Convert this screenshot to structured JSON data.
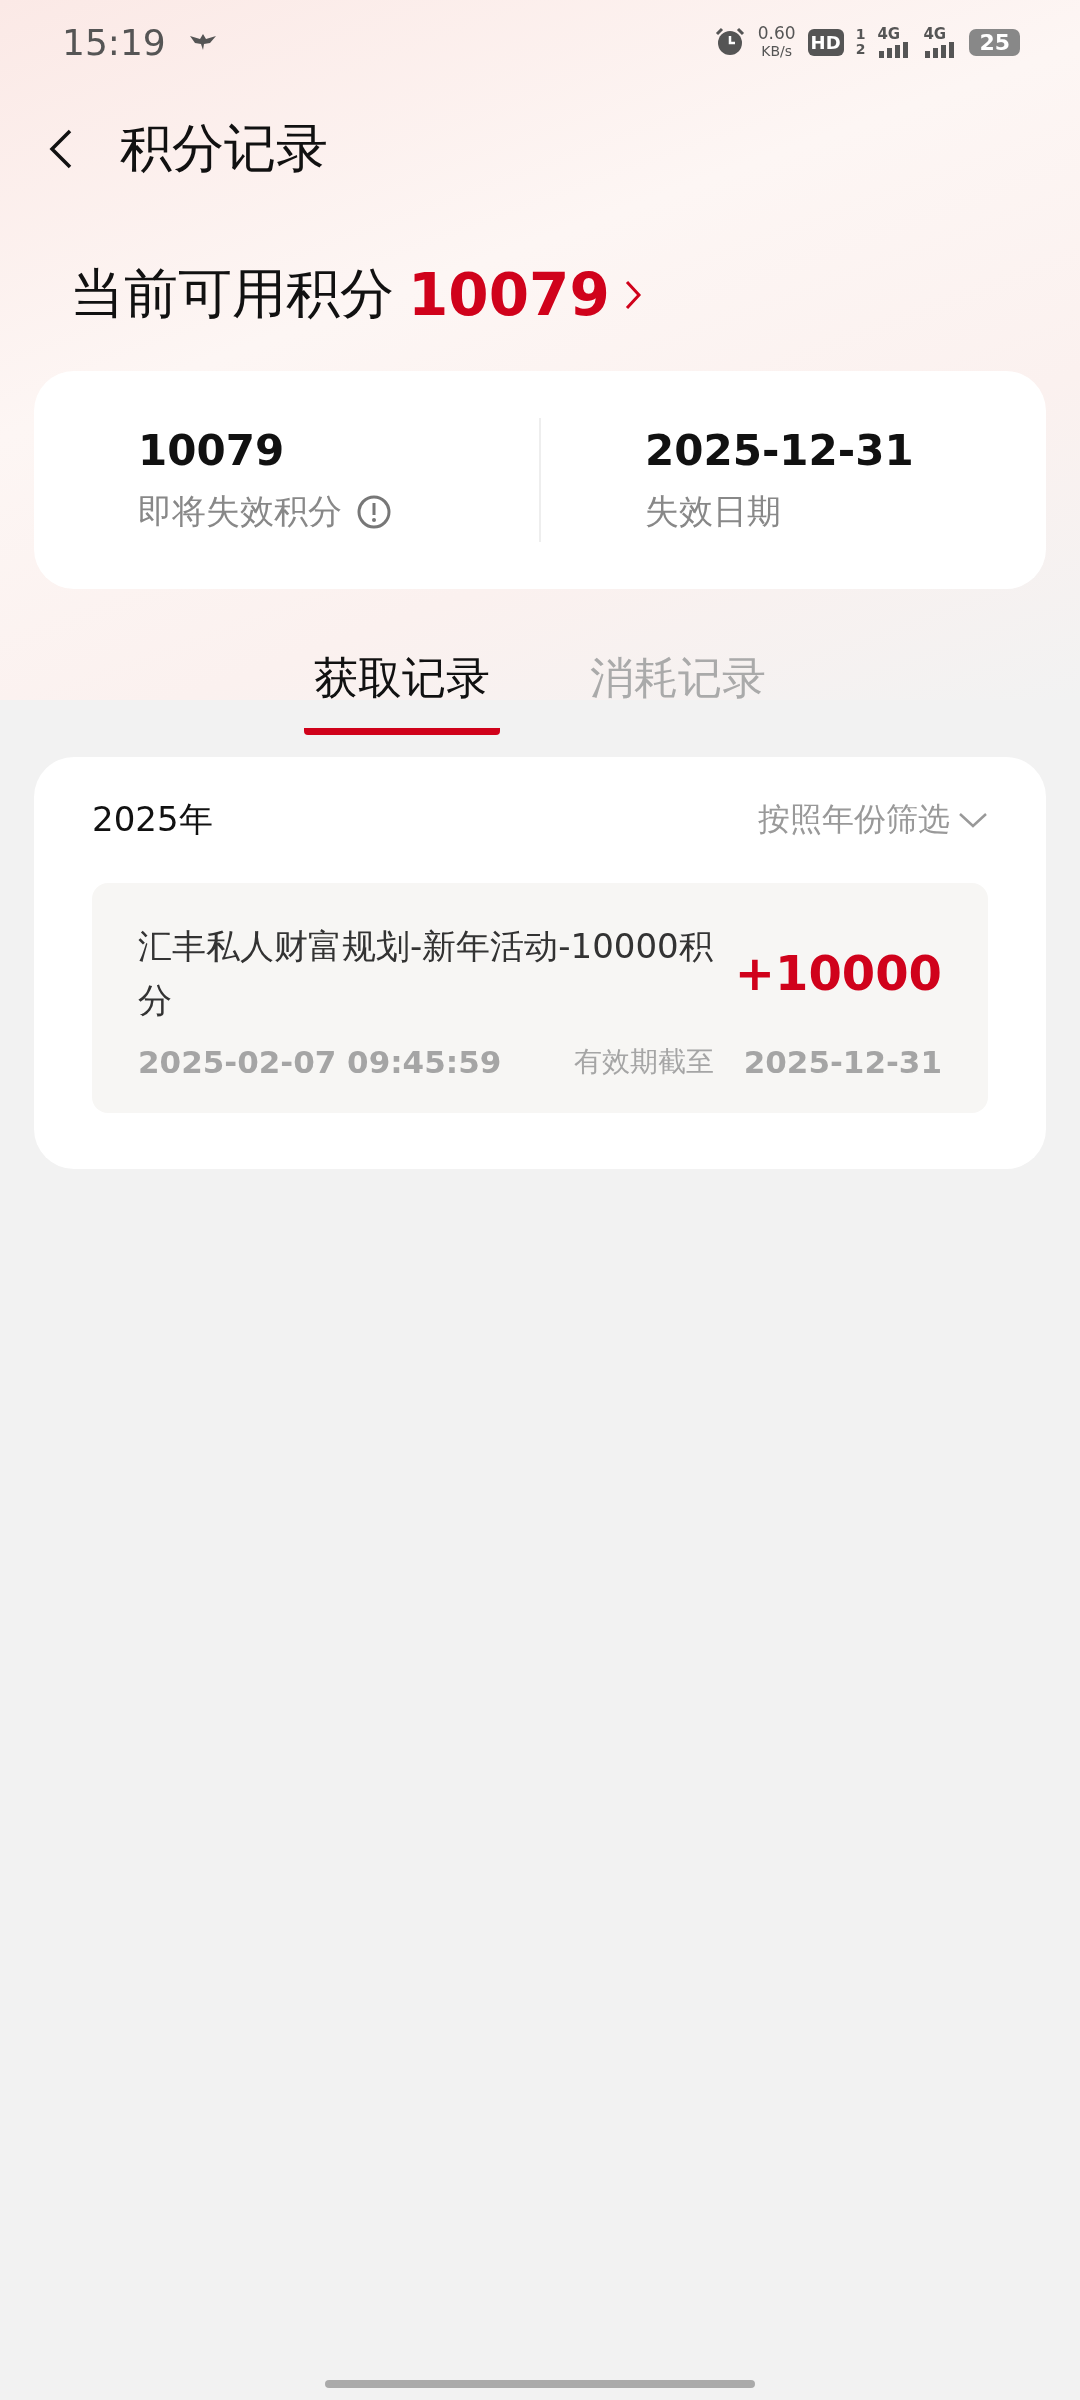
{
  "status_bar": {
    "time": "15:19",
    "net_speed_value": "0.60",
    "net_speed_unit": "KB/s",
    "hd_label": "HD",
    "sim_numbers": [
      "1",
      "2"
    ],
    "signals": [
      {
        "label": "4G"
      },
      {
        "label": "4G"
      }
    ],
    "battery": "25"
  },
  "header": {
    "title": "积分记录"
  },
  "points": {
    "label": "当前可用积分",
    "value": "10079"
  },
  "summary": [
    {
      "value": "10079",
      "label": "即将失效积分",
      "info": true
    },
    {
      "value": "2025-12-31",
      "label": "失效日期",
      "info": false
    }
  ],
  "tabs": [
    {
      "label": "获取记录",
      "selected": true
    },
    {
      "label": "消耗记录",
      "selected": false
    }
  ],
  "records_panel": {
    "year": "2025年",
    "filter": "按照年份筛选",
    "records": [
      {
        "title": "汇丰私人财富规划-新年活动-10000积分",
        "amount": "+10000",
        "time": "2025-02-07 09:45:59",
        "expiry_label": "有效期截至",
        "expiry_date": "2025-12-31"
      }
    ]
  }
}
